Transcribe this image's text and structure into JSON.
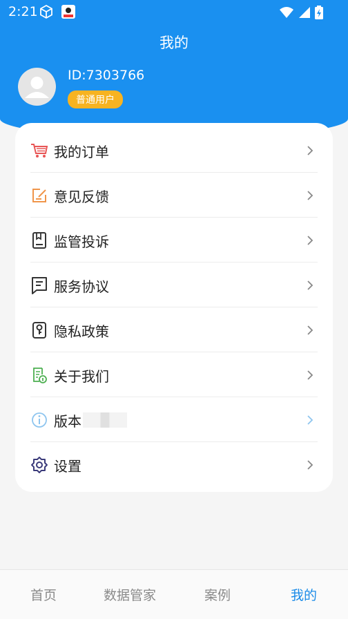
{
  "status": {
    "time": "2:21"
  },
  "header": {
    "title": "我的"
  },
  "profile": {
    "id_text": "ID:7303766",
    "badge": "普通用户"
  },
  "menu": [
    {
      "label": "我的订单",
      "icon": "shopping-cart-icon"
    },
    {
      "label": "意见反馈",
      "icon": "feedback-edit-icon"
    },
    {
      "label": "监管投诉",
      "icon": "bookmark-book-icon"
    },
    {
      "label": "服务协议",
      "icon": "document-lines-icon"
    },
    {
      "label": "隐私政策",
      "icon": "key-lock-icon"
    },
    {
      "label": "关于我们",
      "icon": "info-doc-icon"
    },
    {
      "label": "版本",
      "icon": "version-info-icon"
    },
    {
      "label": "设置",
      "icon": "gear-icon"
    }
  ],
  "tabs": [
    {
      "label": "首页",
      "active": false
    },
    {
      "label": "数据管家",
      "active": false
    },
    {
      "label": "案例",
      "active": false
    },
    {
      "label": "我的",
      "active": true
    }
  ],
  "colors": {
    "primary": "#1a90f0",
    "badge": "#f7b321",
    "active_tab": "#1a8be8"
  }
}
